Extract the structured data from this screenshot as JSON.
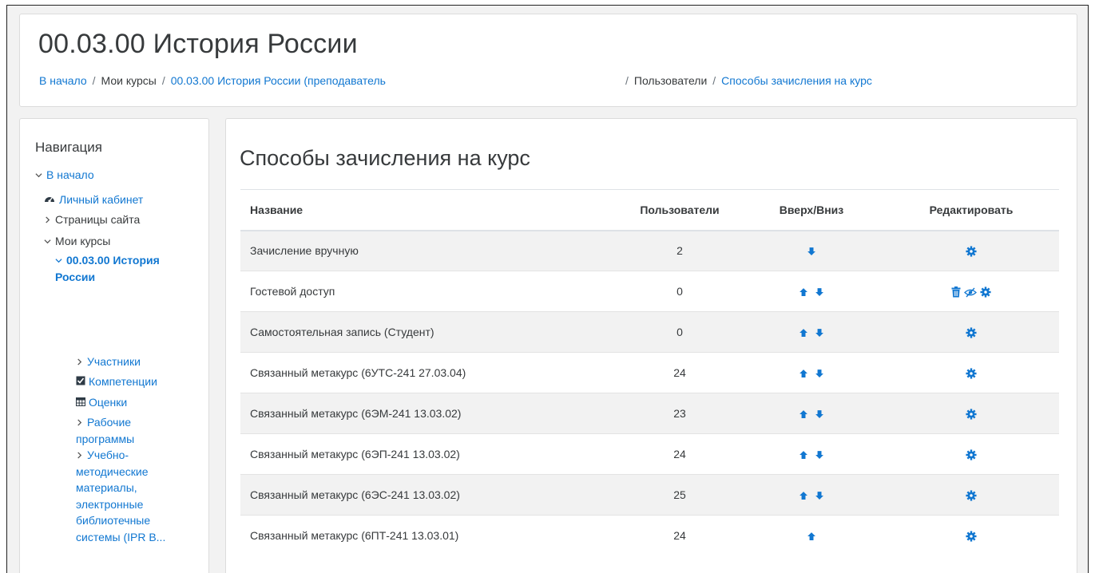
{
  "header": {
    "course_title": "00.03.00 История России",
    "breadcrumb": {
      "home": "В начало",
      "my_courses": "Мои курсы",
      "course": "00.03.00 История России (преподаватель",
      "users": "Пользователи",
      "current": "Способы зачисления на курс"
    }
  },
  "nav": {
    "title": "Навигация",
    "home": "В начало",
    "dashboard": "Личный кабинет",
    "site_pages": "Страницы сайта",
    "my_courses": "Мои курсы",
    "course_line1": "00.03.00 История",
    "course_line2": "России",
    "participants": "Участники",
    "competencies": "Компетенции",
    "grades": "Оценки",
    "work_programs_1": "Рабочие",
    "work_programs_2": "программы",
    "materials_1": "Учебно-",
    "materials_2": "методические",
    "materials_3": "материалы,",
    "materials_4": "электронные",
    "materials_5": "библиотечные",
    "materials_6": "системы (IPR B..."
  },
  "main": {
    "title": "Способы зачисления на курс",
    "columns": {
      "name": "Название",
      "users": "Пользователи",
      "updown": "Вверх/Вниз",
      "edit": "Редактировать"
    },
    "rows": [
      {
        "name": "Зачисление вручную",
        "users": "2",
        "up": false,
        "down": true,
        "delete": false,
        "hide": false,
        "muted": false
      },
      {
        "name": "Гостевой доступ",
        "users": "0",
        "up": true,
        "down": true,
        "delete": true,
        "hide": true,
        "muted": true
      },
      {
        "name": "Самостоятельная запись (Студент)",
        "users": "0",
        "up": true,
        "down": true,
        "delete": false,
        "hide": false,
        "muted": true
      },
      {
        "name": "Связанный метакурс (6УТС-241 27.03.04)",
        "users": "24",
        "up": true,
        "down": true,
        "delete": false,
        "hide": false,
        "muted": false
      },
      {
        "name": "Связанный метакурс (6ЭМ-241 13.03.02)",
        "users": "23",
        "up": true,
        "down": true,
        "delete": false,
        "hide": false,
        "muted": false
      },
      {
        "name": "Связанный метакурс (6ЭП-241 13.03.02)",
        "users": "24",
        "up": true,
        "down": true,
        "delete": false,
        "hide": false,
        "muted": false
      },
      {
        "name": "Связанный метакурс (6ЭС-241 13.03.02)",
        "users": "25",
        "up": true,
        "down": true,
        "delete": false,
        "hide": false,
        "muted": false
      },
      {
        "name": "Связанный метакурс (6ПТ-241 13.03.01)",
        "users": "24",
        "up": true,
        "down": false,
        "delete": false,
        "hide": false,
        "muted": false
      }
    ]
  },
  "colors": {
    "link": "#1177d1",
    "icon": "#1177d1",
    "stripe": "#f2f2f2"
  }
}
